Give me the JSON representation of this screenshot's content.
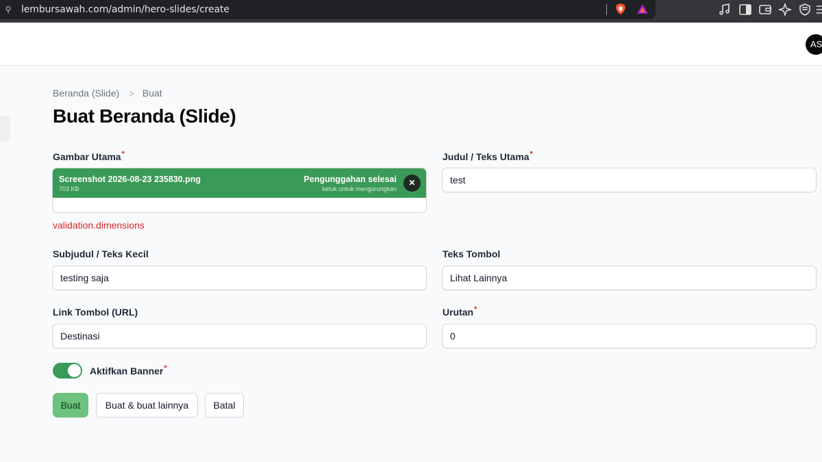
{
  "browser": {
    "url": "lembursawah.com/admin/hero-slides/create"
  },
  "user": {
    "avatar_initials": "AS"
  },
  "breadcrumb": {
    "parent": "Beranda (Slide)",
    "separator": ">",
    "current": "Buat"
  },
  "page_title": "Buat Beranda (Slide)",
  "form": {
    "image": {
      "label": "Gambar Utama",
      "required_mark": "*",
      "file_name": "Screenshot 2026-08-23 235830.png",
      "file_size": "703 KB",
      "status": "Pengunggahan selesai",
      "hint": "ketuk untuk mengurungkan",
      "error": "validation.dimensions"
    },
    "title": {
      "label": "Judul / Teks Utama",
      "required_mark": "*",
      "value": "test"
    },
    "subtitle": {
      "label": "Subjudul / Teks Kecil",
      "value": "testing saja"
    },
    "button_text": {
      "label": "Teks Tombol",
      "value": "Lihat Lainnya"
    },
    "button_link": {
      "label": "Link Tombol (URL)",
      "value": "Destinasi"
    },
    "order": {
      "label": "Urutan",
      "required_mark": "*",
      "value": "0"
    },
    "active": {
      "label": "Aktifkan Banner",
      "required_mark": "*",
      "checked": true
    }
  },
  "actions": {
    "create": "Buat",
    "create_another": "Buat & buat lainnya",
    "cancel": "Batal"
  },
  "colors": {
    "primary": "#6cc27e",
    "success": "#3a9a57",
    "danger": "#dc2626"
  }
}
